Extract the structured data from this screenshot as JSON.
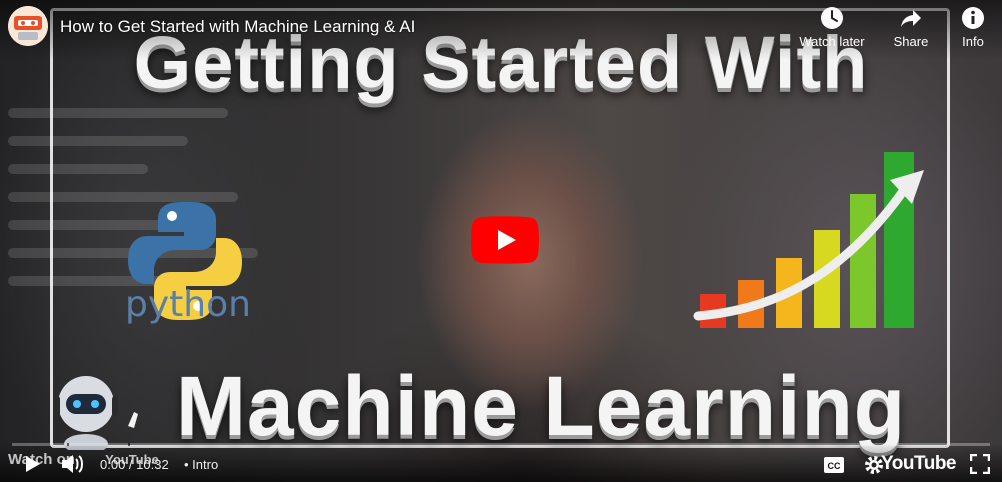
{
  "video": {
    "title": "How to Get Started with Machine Learning & AI",
    "thumbnail_line1": "Getting Started With",
    "thumbnail_line2": "Machine Learning",
    "python_label": "python"
  },
  "top_actions": [
    {
      "label": "Watch later",
      "icon": "clock-icon"
    },
    {
      "label": "Share",
      "icon": "share-arrow-icon"
    },
    {
      "label": "Info",
      "icon": "info-icon"
    }
  ],
  "controls": {
    "watch_on": "Watch on",
    "watch_on_brand": "YouTube",
    "time": "0:00 / 10:32",
    "chapter": "• Intro",
    "youtube_logo": "YouTube",
    "progress_fraction": 0
  },
  "colors": {
    "play_button": "#ff0000",
    "chart_bars": [
      "#e53922",
      "#f07a1a",
      "#f5b51c",
      "#d6d91f",
      "#7cc72b",
      "#2ea82f"
    ]
  }
}
